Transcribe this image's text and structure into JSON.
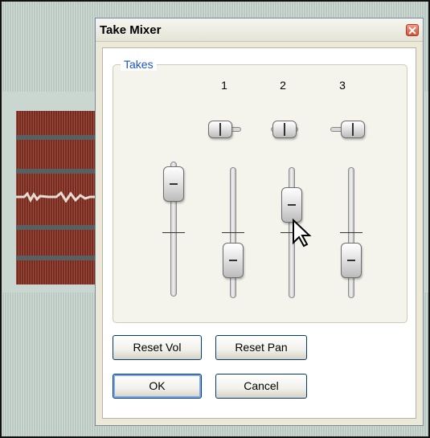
{
  "dialog": {
    "title": "Take Mixer",
    "group_label": "Takes",
    "takes": [
      {
        "label": "1",
        "volume_level": 0.2,
        "pan": 0.0
      },
      {
        "label": "2",
        "volume_level": 0.75,
        "pan": 0.0
      },
      {
        "label": "3",
        "volume_level": 0.2,
        "pan": 0.0
      }
    ],
    "master_volume_level": 0.95,
    "buttons": {
      "reset_vol": "Reset Vol",
      "reset_pan": "Reset Pan",
      "ok": "OK",
      "cancel": "Cancel"
    }
  },
  "colors": {
    "accent": "#1a52c8",
    "media_item": "#7a2a1c",
    "arrange_bg": "#b9c9c2"
  },
  "icons": {
    "close": "close-icon",
    "cursor": "mouse-pointer-icon"
  }
}
